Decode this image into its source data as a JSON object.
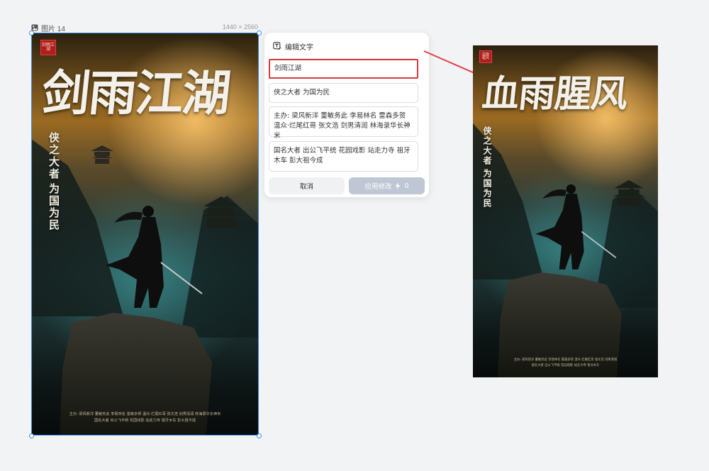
{
  "canvas": {
    "frame_label": "图片 14",
    "frame_dims": "1440 × 2560"
  },
  "poster_original": {
    "seal": "剑雨江湖",
    "title": "剑雨江湖",
    "tagline_1": "侠之大者",
    "tagline_2": "为国为民",
    "credits_line_1": "主办: 梁风新洋  董敏务此  李易林名  雷森多贺  温众·烂尾红哥  张文浩  剑男清润  林海录华长神米",
    "credits_line_2": "国名大者  出公飞平统  花园戏影  站走力寺  祖牙木车  彭大祖今成"
  },
  "poster_edited": {
    "seal": "血雨腥风",
    "title": "血雨腥风",
    "tagline_1": "侠之大者",
    "tagline_2": "为国为民",
    "credits_line_1": "主办: 梁风新洋  董敏务此  李易林名  雷森多贺  温众·烂尾红哥  张文浩  剑男清润",
    "credits_line_2": "国名大者  出公飞平统  花园戏影  站走力寺  祖牙木车"
  },
  "edit_panel": {
    "header": "编辑文字",
    "fields": [
      "剑雨江湖",
      "侠之大者 为国为民",
      "主办: 梁风新洋 董敏务此 李易林名 雷森多贺 温众·烂尾红哥 张文浩 剑男清润 林海录华长神米",
      "国名大者 出公飞平统 花园戏影 站走力寺 祖牙木车 彭大祖今成"
    ],
    "cancel_label": "取消",
    "apply_label": "应用修改",
    "apply_cost": "0"
  },
  "icons": {
    "frame": "image-icon",
    "panel": "edit-text-icon",
    "apply": "lightning-icon"
  },
  "colors": {
    "selection": "#3a8ef0",
    "highlight": "#d9363e",
    "apply_disabled": "#bfc6d4",
    "arrow": "#e0404a"
  }
}
